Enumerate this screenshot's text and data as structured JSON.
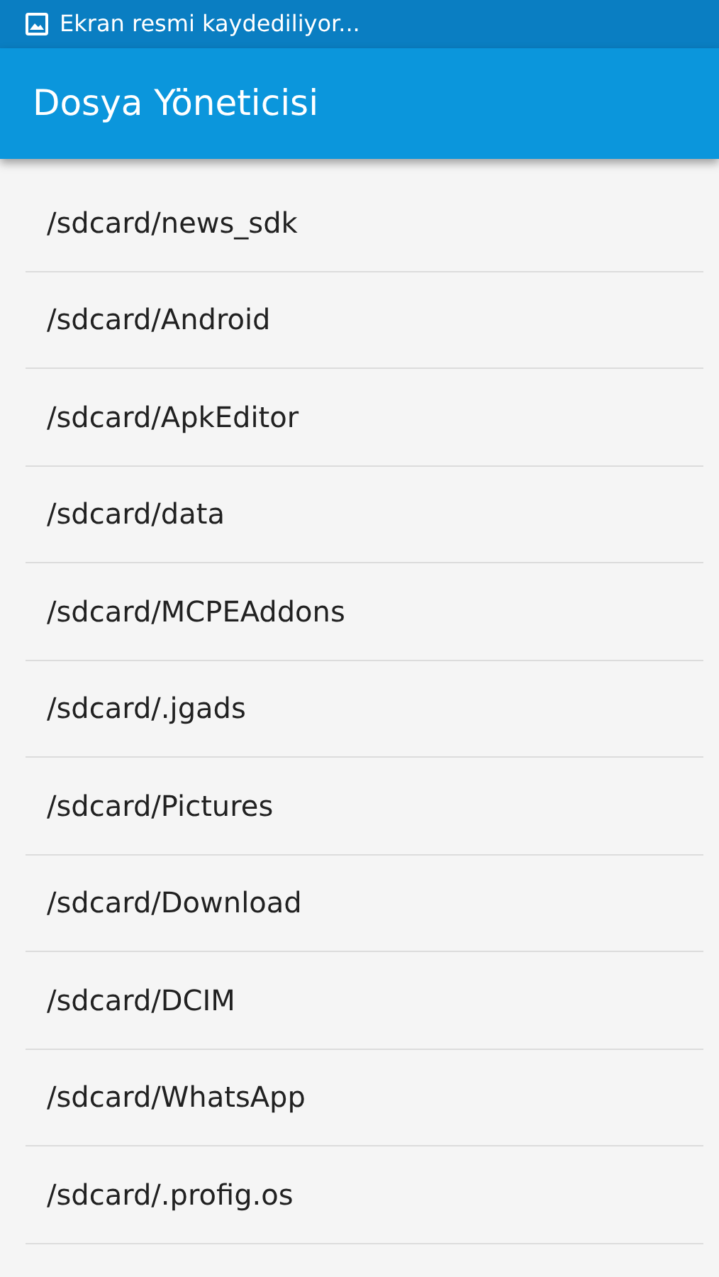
{
  "status_bar": {
    "notification": "Ekran resmi kaydediliyor..."
  },
  "app_bar": {
    "title": "Dosya Yöneticisi"
  },
  "folders": [
    {
      "path": "/sdcard/news_sdk"
    },
    {
      "path": "/sdcard/Android"
    },
    {
      "path": "/sdcard/ApkEditor"
    },
    {
      "path": "/sdcard/data"
    },
    {
      "path": "/sdcard/MCPEAddons"
    },
    {
      "path": "/sdcard/.jgads"
    },
    {
      "path": "/sdcard/Pictures"
    },
    {
      "path": "/sdcard/Download"
    },
    {
      "path": "/sdcard/DCIM"
    },
    {
      "path": "/sdcard/WhatsApp"
    },
    {
      "path": "/sdcard/.profig.os"
    }
  ]
}
